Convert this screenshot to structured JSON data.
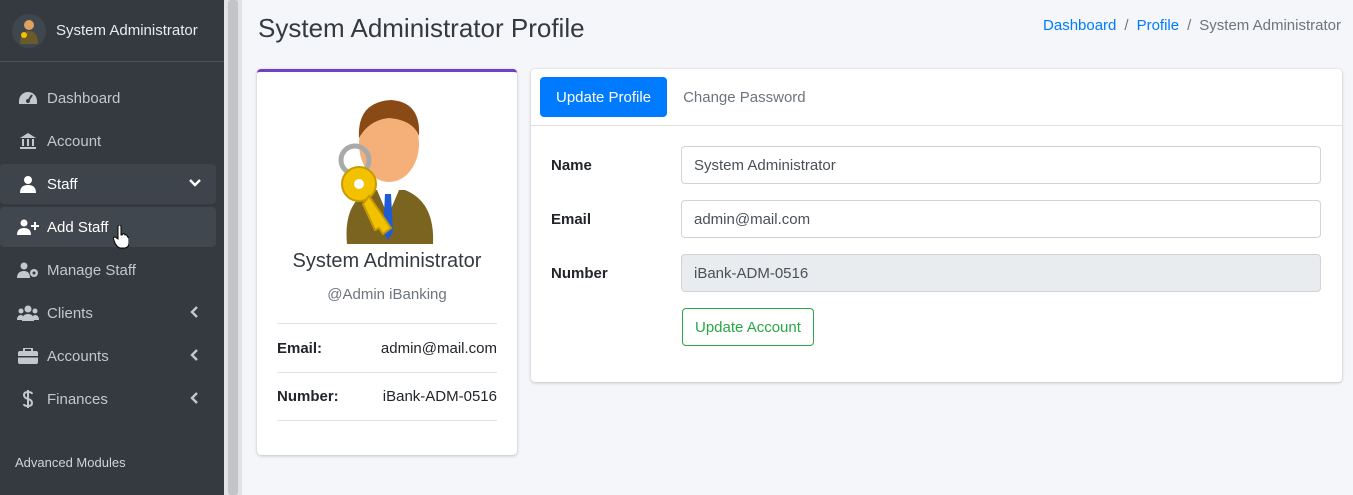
{
  "sidebar": {
    "brand_title": "System Administrator",
    "items": [
      {
        "label": "Dashboard",
        "icon": "tachometer-icon"
      },
      {
        "label": "Account",
        "icon": "bank-icon"
      },
      {
        "label": "Staff",
        "icon": "user-tie-icon",
        "caret": "chevron-down-icon"
      },
      {
        "label": "Add Staff",
        "icon": "user-plus-icon"
      },
      {
        "label": "Manage Staff",
        "icon": "user-cog-icon"
      },
      {
        "label": "Clients",
        "icon": "users-icon",
        "caret": "chevron-left-icon"
      },
      {
        "label": "Accounts",
        "icon": "briefcase-icon",
        "caret": "chevron-left-icon"
      },
      {
        "label": "Finances",
        "icon": "dollar-icon",
        "caret": "chevron-left-icon"
      }
    ],
    "section_header": "Advanced Modules"
  },
  "header": {
    "title": "System Administrator Profile",
    "breadcrumb": [
      "Dashboard",
      "Profile",
      "System Administrator"
    ]
  },
  "profile": {
    "name": "System Administrator",
    "handle": "@Admin iBanking",
    "email_label": "Email:",
    "email": "admin@mail.com",
    "number_label": "Number:",
    "number": "iBank-ADM-0516"
  },
  "form": {
    "tabs": [
      "Update Profile",
      "Change Password"
    ],
    "name_label": "Name",
    "name_value": "System Administrator",
    "email_label": "Email",
    "email_value": "admin@mail.com",
    "number_label": "Number",
    "number_value": "iBank-ADM-0516",
    "submit_label": "Update Account"
  },
  "colors": {
    "sidebar_bg": "#343a40",
    "primary": "#007bff",
    "success": "#28a745",
    "card_accent": "#6f42c1"
  }
}
